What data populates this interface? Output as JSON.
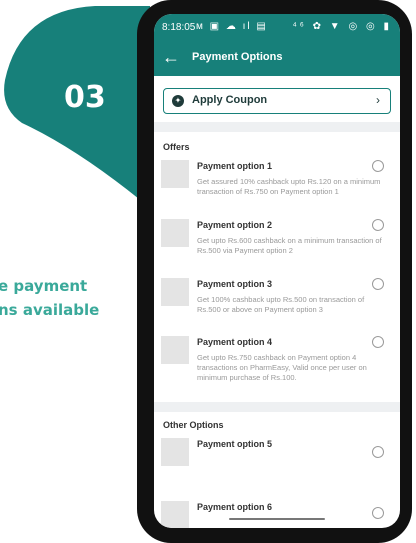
{
  "step": {
    "number": "03"
  },
  "caption": {
    "line1": "e payment",
    "line2": "ns available"
  },
  "status_bar": {
    "time": "8:18:05",
    "left_icons": "ᴍ ▣ ☁ ıl ▤",
    "right_icons": "⁴⁶ ✿ ▼ ◎ ◎ ▮"
  },
  "app_bar": {
    "title": "Payment Options",
    "back_icon": "arrow-left-icon"
  },
  "coupon": {
    "label": "Apply Coupon",
    "icon": "coupon-icon",
    "chevron": "›"
  },
  "offers": {
    "heading": "Offers",
    "items": [
      {
        "title": "Payment option 1",
        "desc": "Get assured 10% cashback upto Rs.120 on a minimum transaction of Rs.750 on Payment option 1"
      },
      {
        "title": "Payment option 2",
        "desc": "Get upto Rs.600 cashback on a minimum transaction of Rs.500 via Payment option 2"
      },
      {
        "title": "Payment option 3",
        "desc": "Get 100% cashback upto Rs.500 on transaction of Rs.500 or above on Payment option 3"
      },
      {
        "title": "Payment option 4",
        "desc": "Get upto Rs.750 cashback on Payment option 4 transactions on PharmEasy, Valid once per user on minimum purchase of Rs.100."
      }
    ]
  },
  "other_options": {
    "heading": "Other Options",
    "items": [
      {
        "title": "Payment option 5",
        "desc": ""
      },
      {
        "title": "Payment option 6",
        "desc": ""
      }
    ]
  },
  "colors": {
    "brand": "#17807a",
    "caption": "#3aa99a"
  }
}
